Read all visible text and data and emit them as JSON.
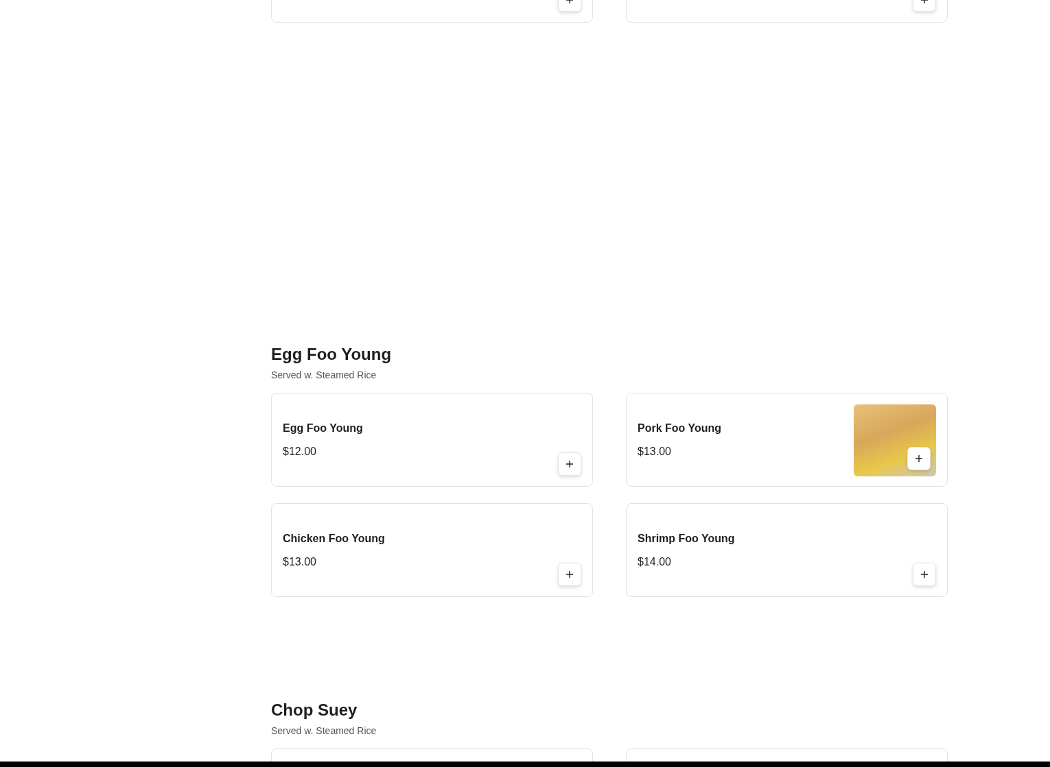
{
  "sections": [
    {
      "items": [
        {
          "add_button": true
        },
        {
          "add_button": true
        }
      ]
    },
    {
      "title": "Egg Foo Young",
      "subtitle": "Served w. Steamed Rice",
      "items": [
        {
          "name": "Egg Foo Young",
          "price": "$12.00",
          "add_button": true,
          "photo": false
        },
        {
          "name": "Pork Foo Young",
          "price": "$13.00",
          "add_button": true,
          "photo": true
        },
        {
          "name": "Chicken Foo Young",
          "price": "$13.00",
          "add_button": true,
          "photo": false
        },
        {
          "name": "Shrimp Foo Young",
          "price": "$14.00",
          "add_button": true,
          "photo": false
        }
      ]
    },
    {
      "title": "Chop Suey",
      "subtitle": "Served w. Steamed Rice",
      "items": [
        {
          "add_button": false
        },
        {
          "add_button": false
        }
      ]
    }
  ]
}
